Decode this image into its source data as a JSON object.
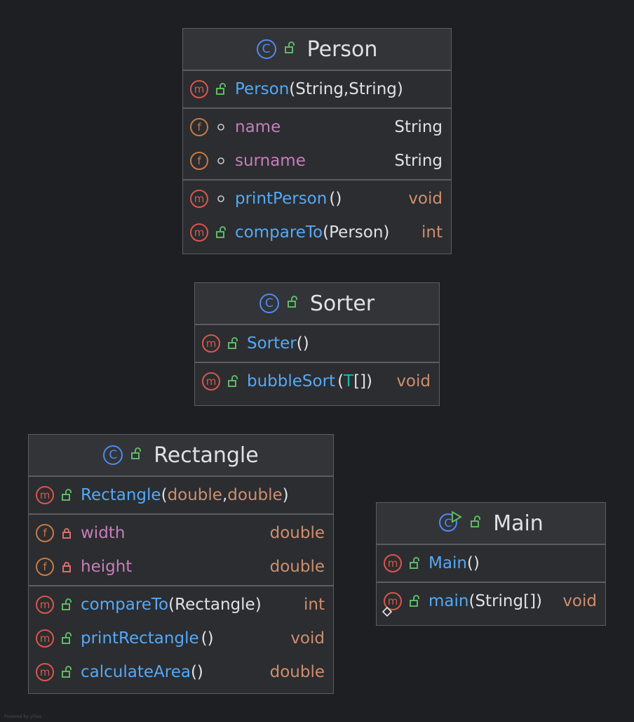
{
  "diagram": {
    "footer": "Powered by yFiles",
    "person": {
      "class_name": "Person",
      "constructor": {
        "name": "Person",
        "open": "(",
        "p1": "String",
        "sep": ", ",
        "p2": "String",
        "close": ")"
      },
      "fields": [
        {
          "name": "name",
          "type": "String"
        },
        {
          "name": "surname",
          "type": "String"
        }
      ],
      "methods": [
        {
          "name": "printPerson",
          "params": "()",
          "ret": "void"
        },
        {
          "name": "compareTo",
          "open": "(",
          "p1": "Person",
          "close": ")",
          "ret": "int"
        }
      ]
    },
    "sorter": {
      "class_name": "Sorter",
      "constructor": {
        "name": "Sorter",
        "params": "()"
      },
      "methods": [
        {
          "name": "bubbleSort",
          "open": "(",
          "tvar": "T",
          "close": "[])",
          "ret": "void"
        }
      ]
    },
    "rectangle": {
      "class_name": "Rectangle",
      "constructor": {
        "name": "Rectangle",
        "open": "(",
        "p1": "double",
        "sep": ", ",
        "p2": "double",
        "close": ")"
      },
      "fields": [
        {
          "name": "width",
          "type": "double"
        },
        {
          "name": "height",
          "type": "double"
        }
      ],
      "methods": [
        {
          "name": "compareTo",
          "open": "(",
          "p1": "Rectangle",
          "close": ")",
          "ret": "int"
        },
        {
          "name": "printRectangle",
          "params": "()",
          "ret": "void"
        },
        {
          "name": "calculateArea",
          "params": "()",
          "ret": "double"
        }
      ]
    },
    "main": {
      "class_name": "Main",
      "constructor": {
        "name": "Main",
        "params": "()"
      },
      "methods": [
        {
          "name": "main",
          "open": "(",
          "p1": "String",
          "close": "[])",
          "ret": "void"
        }
      ]
    },
    "glyphs": {
      "class": "C",
      "method": "m",
      "field": "f"
    },
    "colors": {
      "method": "#56a8f5",
      "field": "#c77dbb",
      "keyword": "#cf8e6d",
      "type_var": "#16baac",
      "public": "#5fb865",
      "private": "#e06c6c"
    }
  }
}
